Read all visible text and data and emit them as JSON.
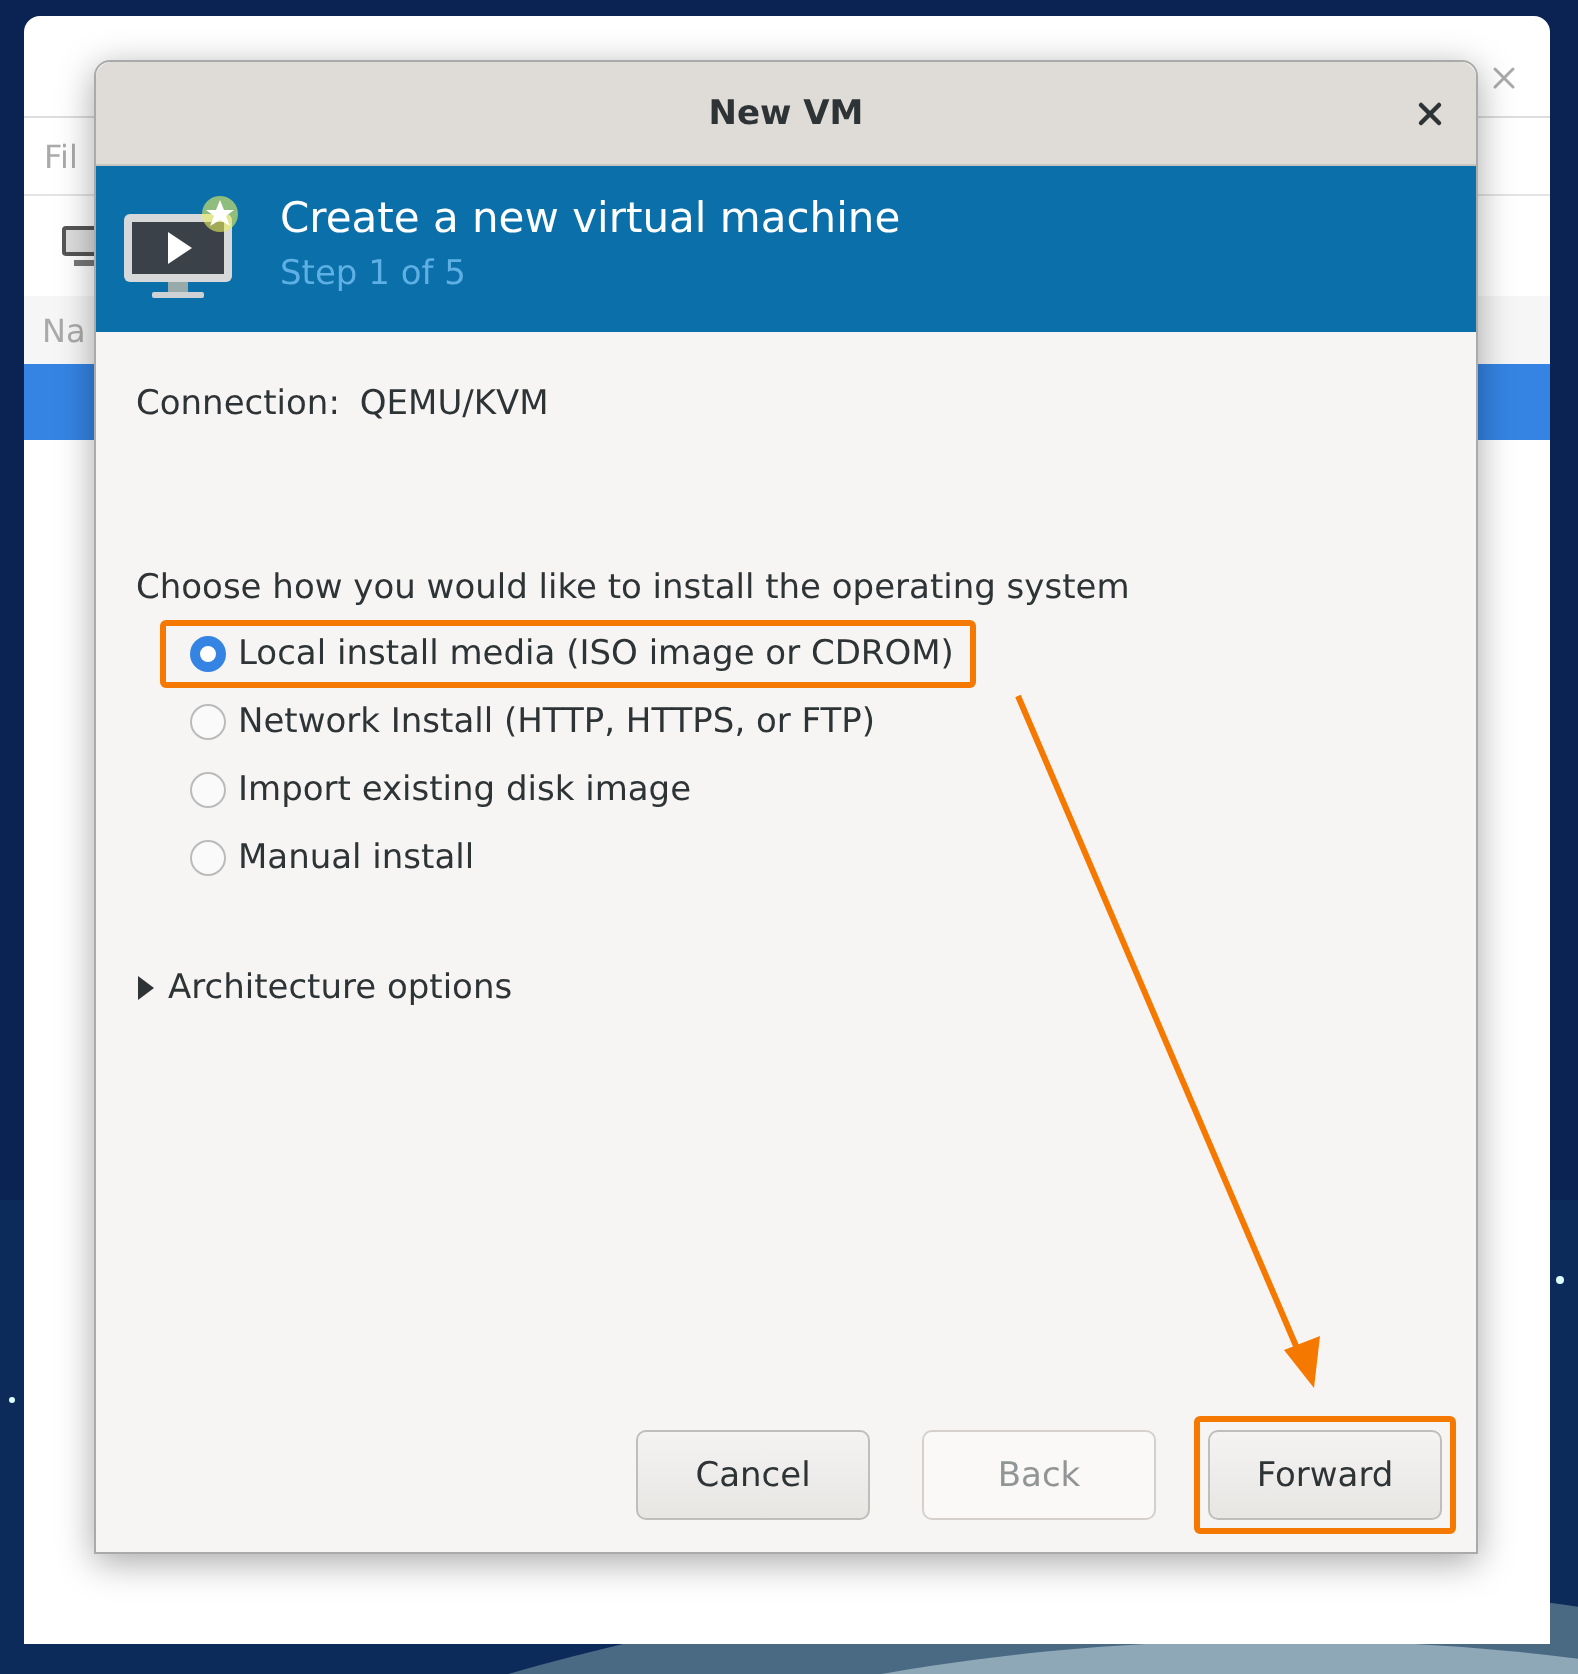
{
  "background_window": {
    "menu": [
      "Fil"
    ],
    "column_header": "Na"
  },
  "dialog": {
    "title": "New VM",
    "banner": {
      "title": "Create a new virtual machine",
      "step": "Step 1 of 5"
    },
    "connection": {
      "label": "Connection:",
      "value": "QEMU/KVM"
    },
    "prompt": "Choose how you would like to install the operating system",
    "options": [
      {
        "label": "Local install media (ISO image or CDROM)",
        "selected": true,
        "highlighted": true
      },
      {
        "label": "Network Install (HTTP, HTTPS, or FTP)",
        "selected": false,
        "highlighted": false
      },
      {
        "label": "Import existing disk image",
        "selected": false,
        "highlighted": false
      },
      {
        "label": "Manual install",
        "selected": false,
        "highlighted": false
      }
    ],
    "expander": {
      "label": "Architecture options",
      "expanded": false
    },
    "buttons": [
      {
        "label": "Cancel",
        "disabled": false,
        "highlighted": false
      },
      {
        "label": "Back",
        "disabled": true,
        "highlighted": false
      },
      {
        "label": "Forward",
        "disabled": false,
        "highlighted": true
      }
    ]
  }
}
